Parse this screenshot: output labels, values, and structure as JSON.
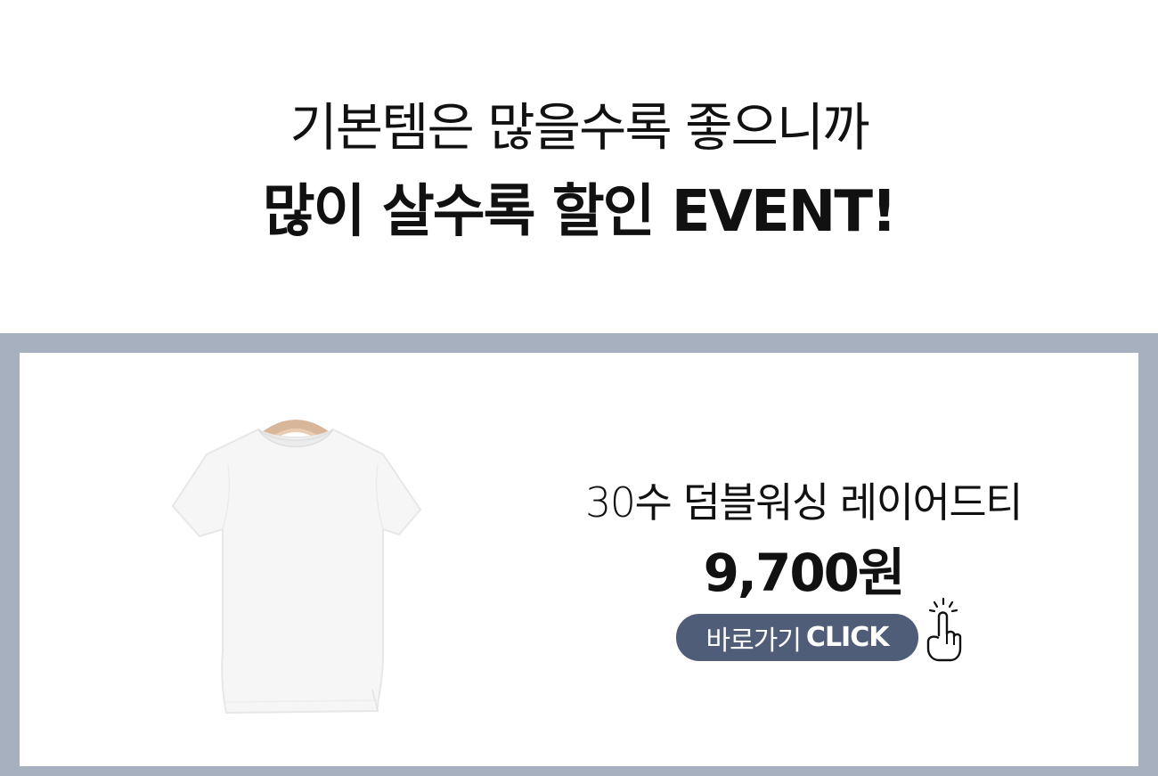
{
  "banner": {
    "headline_line1": "기본템은 많을수록 좋으니까",
    "headline_line2": "많이 살수록 할인 EVENT!"
  },
  "product": {
    "name": "30수 덤블워싱 레이어드티",
    "price": "9,700원",
    "image_icon": "white-tshirt-on-hanger"
  },
  "cta": {
    "label_korean": "바로가기",
    "label_english": "CLICK",
    "icon": "pointing-hand-icon"
  },
  "colors": {
    "frame": "#a7b0bf",
    "cta_background": "#4f5d79",
    "text": "#111111",
    "background": "#ffffff"
  }
}
